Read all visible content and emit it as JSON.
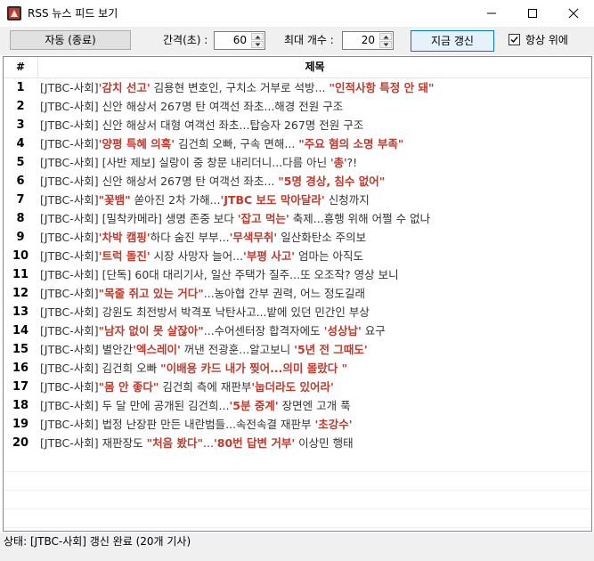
{
  "window": {
    "title": "RSS 뉴스 피드 보기",
    "icon": "rss-app-icon"
  },
  "toolbar": {
    "auto_button": "자동 (종료)",
    "interval_label": "간격(초) :",
    "interval_value": "60",
    "max_label": "최대 개수 :",
    "max_value": "20",
    "refresh_button": "지금 갱신",
    "always_on_top_label": "항상 위에",
    "always_on_top_checked": true
  },
  "table": {
    "columns": [
      "#",
      "제목"
    ],
    "rows": [
      {
        "num": "1",
        "segments": [
          {
            "t": "[JTBC-사회]",
            "red": false
          },
          {
            "t": "'감치 선고'",
            "red": true
          },
          {
            "t": " 김용현 변호인, 구치소 거부로 석방... ",
            "red": false
          },
          {
            "t": "\"인적사항 특정 안 돼\"",
            "red": true
          }
        ]
      },
      {
        "num": "2",
        "segments": [
          {
            "t": "[JTBC-사회] 신안 해상서 267명 탄 여객선 좌초...해경 전원 구조",
            "red": false
          }
        ]
      },
      {
        "num": "3",
        "segments": [
          {
            "t": "[JTBC-사회] 신안 해상서 대형 여객선 좌초...탑승자 267명 전원 구조",
            "red": false
          }
        ]
      },
      {
        "num": "4",
        "segments": [
          {
            "t": "[JTBC-사회]",
            "red": false
          },
          {
            "t": "'양평 특혜 의혹'",
            "red": true
          },
          {
            "t": " 김건희 오빠, 구속 면해... ",
            "red": false
          },
          {
            "t": "\"주요 혐의 소명 부족\"",
            "red": true
          }
        ]
      },
      {
        "num": "5",
        "segments": [
          {
            "t": "[JTBC-사회] [사반 제보] 실랑이 중 창문 내리더니...다름 아닌 '",
            "red": false
          },
          {
            "t": "총",
            "red": true
          },
          {
            "t": "'?!",
            "red": false
          }
        ]
      },
      {
        "num": "6",
        "segments": [
          {
            "t": "[JTBC-사회] 신안 해상서 267명 탄 여객선 좌초... ",
            "red": false
          },
          {
            "t": "\"5명 경상, 침수 없어\"",
            "red": true
          }
        ]
      },
      {
        "num": "7",
        "segments": [
          {
            "t": "[JTBC-사회]",
            "red": false
          },
          {
            "t": "\"꽃뱀\"",
            "red": true
          },
          {
            "t": " 쏟아진 2차 가해...",
            "red": false
          },
          {
            "t": "'JTBC 보도 막아달라'",
            "red": true
          },
          {
            "t": " 신청까지",
            "red": false
          }
        ]
      },
      {
        "num": "8",
        "segments": [
          {
            "t": "[JTBC-사회] [밀착카메라] 생명 존중 보다 ",
            "red": false
          },
          {
            "t": "'잡고 먹는'",
            "red": true
          },
          {
            "t": " 축제...흥행 위해 어쩔 수 없나",
            "red": false
          }
        ]
      },
      {
        "num": "9",
        "segments": [
          {
            "t": "[JTBC-사회]",
            "red": false
          },
          {
            "t": "'차박 캠핑'",
            "red": true
          },
          {
            "t": "하다 숨진 부부...",
            "red": false
          },
          {
            "t": "'무색무취'",
            "red": true
          },
          {
            "t": " 일산화탄소 주의보",
            "red": false
          }
        ]
      },
      {
        "num": "10",
        "segments": [
          {
            "t": "[JTBC-사회]",
            "red": false
          },
          {
            "t": "'트럭 돌진'",
            "red": true
          },
          {
            "t": " 시장 사망자 늘어...",
            "red": false
          },
          {
            "t": "'부평 사고'",
            "red": true
          },
          {
            "t": " 엄마는 아직도",
            "red": false
          }
        ]
      },
      {
        "num": "11",
        "segments": [
          {
            "t": "[JTBC-사회] [단독] 60대 대리기사, 일산 주택가 질주...또 오조작? 영상 보니",
            "red": false
          }
        ]
      },
      {
        "num": "12",
        "segments": [
          {
            "t": "[JTBC-사회]",
            "red": false
          },
          {
            "t": "\"목줄 쥐고 있는 거다\"",
            "red": true
          },
          {
            "t": "...농아협 간부 권력, 어느 정도길래",
            "red": false
          }
        ]
      },
      {
        "num": "13",
        "segments": [
          {
            "t": "[JTBC-사회] 강원도 최전방서 박격포 낙탄사고...밭에 있던 민간인 부상",
            "red": false
          }
        ]
      },
      {
        "num": "14",
        "segments": [
          {
            "t": "[JTBC-사회]",
            "red": false
          },
          {
            "t": "\"남자 없이 못 살잖아\"",
            "red": true
          },
          {
            "t": "...수어센터장 합격자에도 ",
            "red": false
          },
          {
            "t": "'성상납'",
            "red": true
          },
          {
            "t": " 요구",
            "red": false
          }
        ]
      },
      {
        "num": "15",
        "segments": [
          {
            "t": "[JTBC-사회] 별안간",
            "red": false
          },
          {
            "t": "'엑스레이'",
            "red": true
          },
          {
            "t": " 꺼낸 전광훈...알고보니 ",
            "red": false
          },
          {
            "t": "'5년 전 그때도'",
            "red": true
          }
        ]
      },
      {
        "num": "16",
        "segments": [
          {
            "t": "[JTBC-사회] 김건희 오빠 ",
            "red": false
          },
          {
            "t": "\"이배용 카드 내가 찢어...의미 몰랐다 \"",
            "red": true
          }
        ]
      },
      {
        "num": "17",
        "segments": [
          {
            "t": "[JTBC-사회]",
            "red": false
          },
          {
            "t": "\"몸 안 좋다\"",
            "red": true
          },
          {
            "t": " 김건희 측에 재판부",
            "red": false
          },
          {
            "t": "'눕더라도 있어라'",
            "red": true
          }
        ]
      },
      {
        "num": "18",
        "segments": [
          {
            "t": "[JTBC-사회] 두 달 만에 공개된 김건희...",
            "red": false
          },
          {
            "t": "'5분 중계'",
            "red": true
          },
          {
            "t": " 장면엔 고개 푹",
            "red": false
          }
        ]
      },
      {
        "num": "19",
        "segments": [
          {
            "t": "[JTBC-사회] 법정 난장판 만든 내란범들...속전속결 재판부 ",
            "red": false
          },
          {
            "t": "'초강수'",
            "red": true
          }
        ]
      },
      {
        "num": "20",
        "segments": [
          {
            "t": "[JTBC-사회] 재판장도 ",
            "red": false
          },
          {
            "t": "\"처음 봤다\"",
            "red": true
          },
          {
            "t": "...",
            "red": false
          },
          {
            "t": "'80번 답변 거부'",
            "red": true
          },
          {
            "t": " 이상민 행태",
            "red": false
          }
        ]
      }
    ]
  },
  "status": {
    "text": "상태: [JTBC-사회] 갱신 완료 (20개 기사)"
  },
  "colors": {
    "red_text": "#c0392b",
    "normal_text": "#333333",
    "accent": "#0078d7"
  }
}
